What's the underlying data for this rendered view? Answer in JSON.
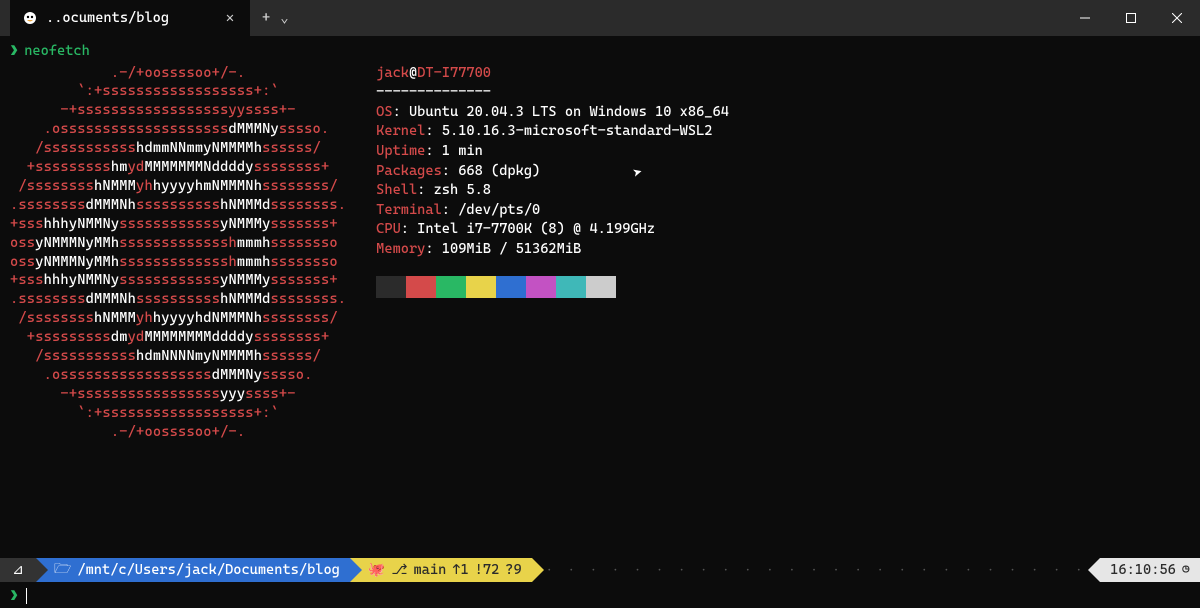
{
  "titlebar": {
    "tab_title": "..ocuments/blog",
    "tab_icon_color": "#e8a33d"
  },
  "prompt": {
    "symbol": "❯",
    "command": "neofetch"
  },
  "ascii_art": [
    "            .-/+oossssoo+/-.",
    "        `:+ssssssssssssssssss+:`",
    "      -+ssssssssssssssssssyyssss+-",
    "    .ossssssssssssssssssss<w>dMMMNy</w>sssso.",
    "   /sssssssssss<w>hdmmNNmmyNMMMMh</w>ssssss/",
    "  +sssssssss<w>hm</w>yd<w>MMMMMMMNddddy</w>ssssssss+",
    " /ssssssss<w>hNMMM</w>yh<w>hyyyyhmNMMMNh</w>ssssssss/",
    ".ssssssss<w>dMMMNh</w>ssssssssss<w>hNMMMd</w>ssssssss.",
    "+sss<w>hhhyNMMNy</w>ssssssssssss<w>yNMMMy</w>sssssss+",
    "oss<w>yNMMMNyMMh</w>sssssssssssssh<w>mmmh</w>ssssssso",
    "oss<w>yNMMMNyMMh</w>sssssssssssssh<w>mmmh</w>ssssssso",
    "+sss<w>hhhyNMMNy</w>ssssssssssss<w>yNMMMy</w>sssssss+",
    ".ssssssss<w>dMMMNh</w>ssssssssss<w>hNMMMd</w>ssssssss.",
    " /ssssssss<w>hNMMM</w>yh<w>hyyyyhdNMMMNh</w>ssssssss/",
    "  +sssssssss<w>dm</w>yd<w>MMMMMMMMddddy</w>ssssssss+",
    "   /sssssssssss<w>hdmNNNNmyNMMMMh</w>ssssss/",
    "    .ossssssssssssssssss<w>dMMMNy</w>sssso.",
    "      -+sssssssssssssssss<w>yyy</w>ssss+-",
    "        `:+ssssssssssssssssss+:`",
    "            .-/+oossssoo+/-."
  ],
  "userhost": {
    "user": "jack",
    "at": "@",
    "host": "DT-I77700"
  },
  "divider": "--------------",
  "info": [
    {
      "label": "OS",
      "value": "Ubuntu 20.04.3 LTS on Windows 10 x86_64"
    },
    {
      "label": "Kernel",
      "value": "5.10.16.3-microsoft-standard-WSL2"
    },
    {
      "label": "Uptime",
      "value": "1 min"
    },
    {
      "label": "Packages",
      "value": "668 (dpkg)"
    },
    {
      "label": "Shell",
      "value": "zsh 5.8"
    },
    {
      "label": "Terminal",
      "value": "/dev/pts/0"
    },
    {
      "label": "CPU",
      "value": "Intel i7-7700K (8) @ 4.199GHz"
    },
    {
      "label": "Memory",
      "value": "109MiB / 51362MiB"
    }
  ],
  "colors": [
    "#2b2b2b",
    "#d44a4a",
    "#29b864",
    "#e8d34a",
    "#2f6fd1",
    "#c352c3",
    "#3fb8b8",
    "#cccccc"
  ],
  "status": {
    "os_icon": "⊿",
    "folder_icon": "🗁",
    "path": "/mnt/c/Users/jack/Documents/blog",
    "git_icon": "⎇",
    "git_branch": "main",
    "git_ahead": "↑1",
    "git_dirty": "!72",
    "git_untracked": "?9",
    "time": "16:10:56",
    "clock_icon": "◷"
  },
  "bottom_prompt": "❯"
}
